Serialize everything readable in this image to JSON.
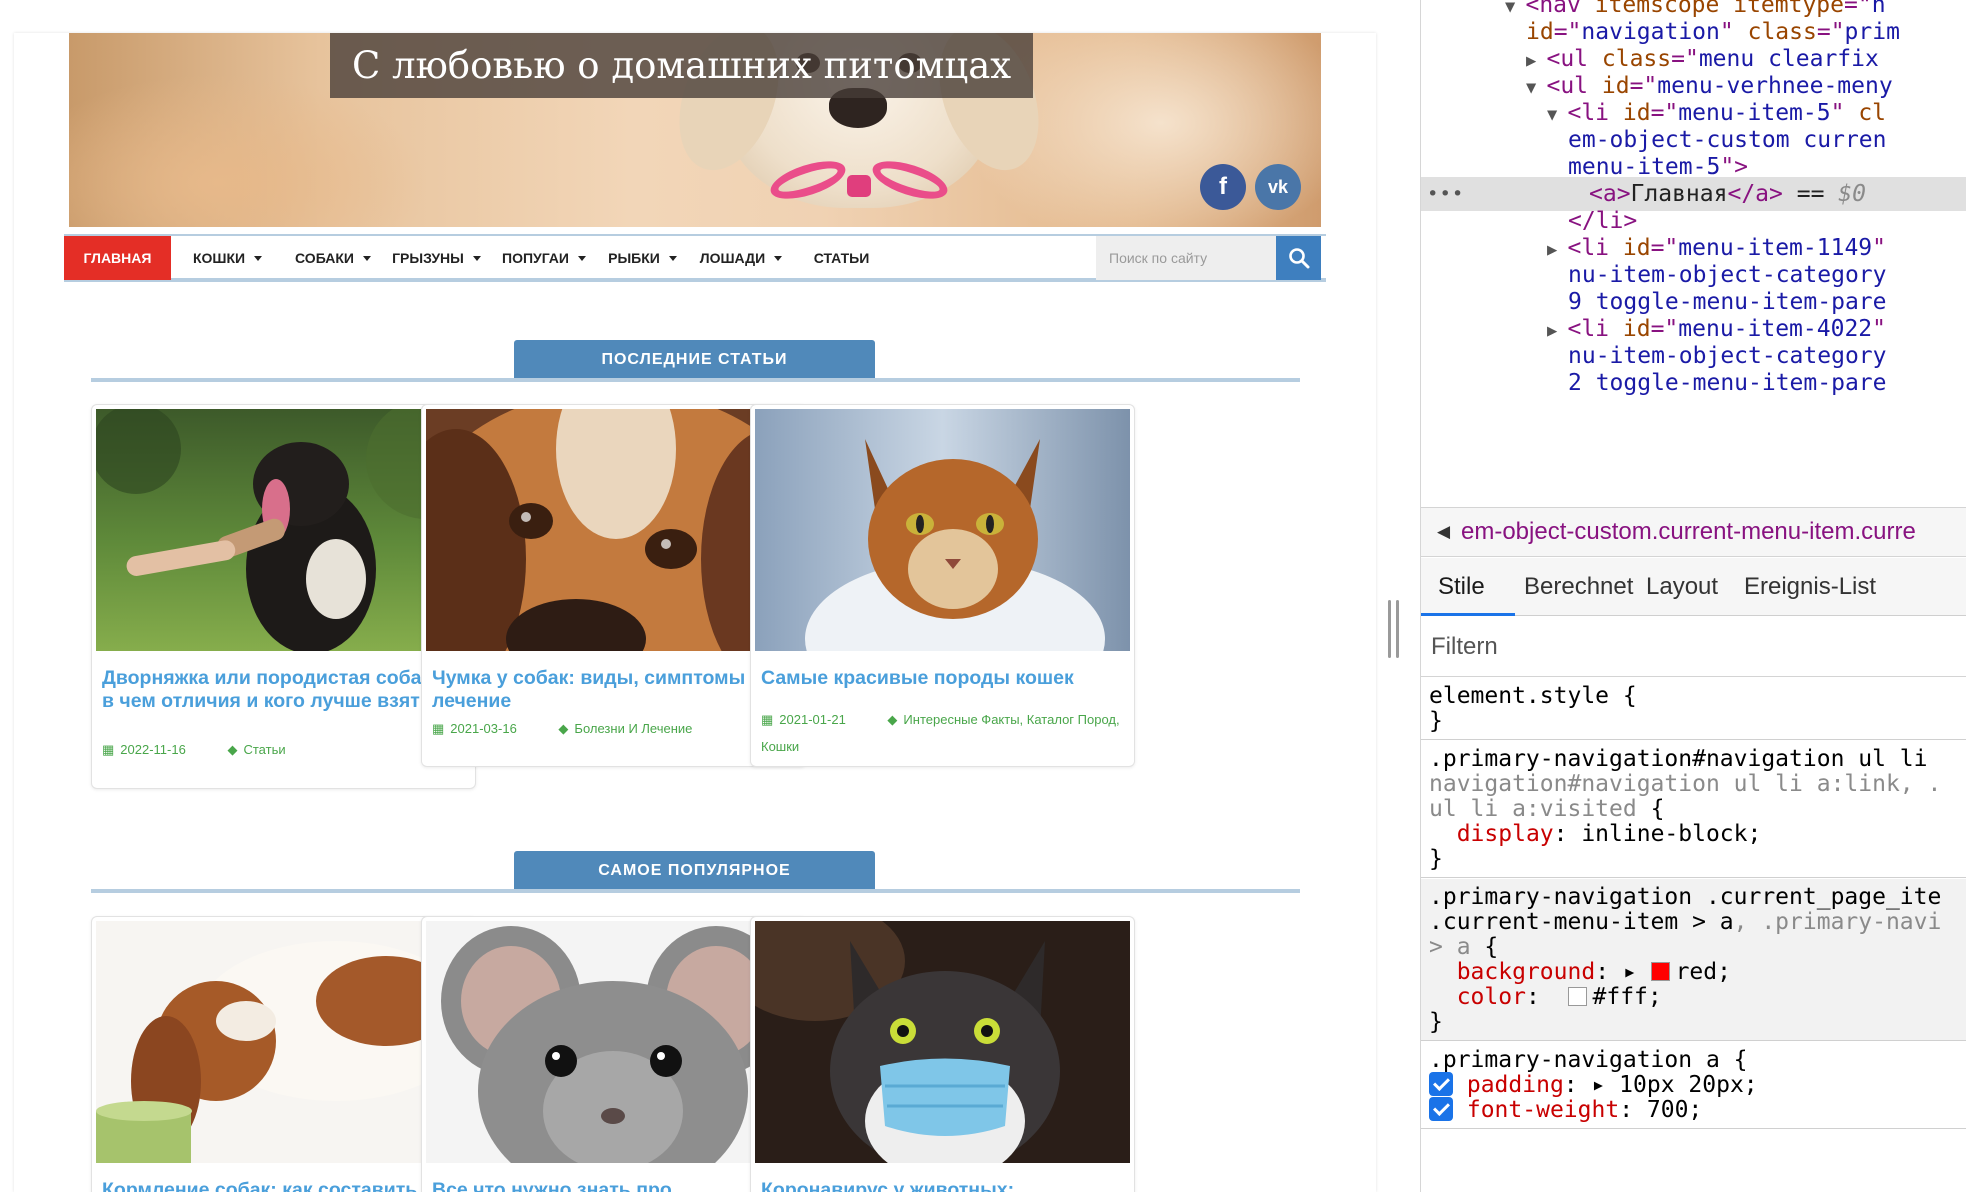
{
  "site": {
    "title": "С любовью о домашних питомцах",
    "social": {
      "facebook": "f",
      "vk": "vk"
    },
    "nav": {
      "items": [
        {
          "label": "Главная",
          "active": true,
          "dropdown": false
        },
        {
          "label": "Кошки",
          "dropdown": true
        },
        {
          "label": "Собаки",
          "dropdown": true
        },
        {
          "label": "Грызуны",
          "dropdown": true
        },
        {
          "label": "Попугаи",
          "dropdown": true
        },
        {
          "label": "Рыбки",
          "dropdown": true
        },
        {
          "label": "Лошади",
          "dropdown": true
        },
        {
          "label": "Статьи",
          "dropdown": false
        }
      ],
      "search_placeholder": "Поиск по сайту"
    },
    "latest": {
      "heading": "Последние статьи",
      "cards": [
        {
          "title": "Дворняжка или породистая собака: в чем отличия и кого лучше взять?",
          "date": "2022-11-16",
          "category": "Статьи",
          "image": "dog-paw-photo"
        },
        {
          "title": "Чумка у собак: виды, симптомы и лечение",
          "date": "2021-03-16",
          "category": "Болезни И Лечение",
          "image": "beagle-photo"
        },
        {
          "title": "Самые красивые породы кошек",
          "date": "2021-01-21",
          "category": "Интересные Факты, Каталог Пород, Кошки",
          "image": "abyssinian-cat-photo"
        }
      ]
    },
    "popular": {
      "heading": "Самое популярное",
      "cards": [
        {
          "title": "Кормление собак: как составить",
          "image": "spaniel-eating-photo"
        },
        {
          "title": "Все что нужно знать про",
          "image": "chinchilla-photo"
        },
        {
          "title": "Коронавирус у животных:",
          "image": "cat-mask-photo"
        }
      ]
    },
    "colors": {
      "accent": "#5089ba",
      "nav_active": "#e42e26",
      "link": "#4a9fdb",
      "meta": "#49a64a"
    }
  },
  "devtools": {
    "dom_lines": [
      {
        "indent": 4,
        "tri": "▼",
        "parts": [
          [
            "tag",
            "<nav "
          ],
          [
            "attr",
            "itemscope"
          ],
          [
            "tag",
            " "
          ],
          [
            "attr",
            "itemtype"
          ],
          [
            "tag",
            "=\""
          ],
          [
            "val",
            "h"
          ]
        ]
      },
      {
        "indent": 5,
        "tri": "",
        "parts": [
          [
            "attr",
            "id"
          ],
          [
            "tag",
            "=\""
          ],
          [
            "val",
            "navigation"
          ],
          [
            "tag",
            "\" "
          ],
          [
            "attr",
            "class"
          ],
          [
            "tag",
            "=\""
          ],
          [
            "val",
            "prim"
          ]
        ]
      },
      {
        "indent": 5,
        "tri": "▶",
        "parts": [
          [
            "tag",
            "<ul "
          ],
          [
            "attr",
            "class"
          ],
          [
            "tag",
            "=\""
          ],
          [
            "val",
            "menu clearfix"
          ]
        ]
      },
      {
        "indent": 5,
        "tri": "▼",
        "parts": [
          [
            "tag",
            "<ul "
          ],
          [
            "attr",
            "id"
          ],
          [
            "tag",
            "=\""
          ],
          [
            "val",
            "menu-verhnee-meny"
          ]
        ]
      },
      {
        "indent": 6,
        "tri": "▼",
        "parts": [
          [
            "tag",
            "<li "
          ],
          [
            "attr",
            "id"
          ],
          [
            "tag",
            "=\""
          ],
          [
            "val",
            "menu-item-5"
          ],
          [
            "tag",
            "\" "
          ],
          [
            "attr",
            "cl"
          ]
        ]
      },
      {
        "indent": 7,
        "tri": "",
        "parts": [
          [
            "val",
            "em-object-custom curren"
          ]
        ]
      },
      {
        "indent": 7,
        "tri": "",
        "parts": [
          [
            "val",
            "menu-item-5"
          ],
          [
            "tag",
            "\">"
          ]
        ]
      },
      {
        "indent": 8,
        "tri": "",
        "selected": true,
        "parts": [
          [
            "tag",
            "<a>"
          ],
          [
            "txt",
            "Главная"
          ],
          [
            "tag",
            "</a>"
          ],
          [
            "txt",
            " == "
          ],
          [
            "dim",
            "$0"
          ]
        ]
      },
      {
        "indent": 7,
        "tri": "",
        "parts": [
          [
            "tag",
            "</li>"
          ]
        ]
      },
      {
        "indent": 6,
        "tri": "▶",
        "parts": [
          [
            "tag",
            "<li "
          ],
          [
            "attr",
            "id"
          ],
          [
            "tag",
            "=\""
          ],
          [
            "val",
            "menu-item-1149"
          ],
          [
            "tag",
            "\""
          ]
        ]
      },
      {
        "indent": 7,
        "tri": "",
        "parts": [
          [
            "val",
            "nu-item-object-category"
          ]
        ]
      },
      {
        "indent": 7,
        "tri": "",
        "parts": [
          [
            "val",
            "9 toggle-menu-item-pare"
          ]
        ]
      },
      {
        "indent": 6,
        "tri": "▶",
        "parts": [
          [
            "tag",
            "<li "
          ],
          [
            "attr",
            "id"
          ],
          [
            "tag",
            "=\""
          ],
          [
            "val",
            "menu-item-4022"
          ],
          [
            "tag",
            "\""
          ]
        ]
      },
      {
        "indent": 7,
        "tri": "",
        "parts": [
          [
            "val",
            "nu-item-object-category"
          ]
        ]
      },
      {
        "indent": 7,
        "tri": "",
        "parts": [
          [
            "val",
            "2 toggle-menu-item-pare"
          ]
        ]
      }
    ],
    "breadcrumb": "em-object-custom.current-menu-item.curre",
    "tabs": [
      "Stile",
      "Berechnet",
      "Layout",
      "Ereignis-List"
    ],
    "filter_placeholder": "Filtern",
    "rules": [
      {
        "lines": [
          [
            [
              "plain",
              "element.style {"
            ]
          ],
          [
            [
              "plain",
              "}"
            ]
          ]
        ]
      },
      {
        "lines": [
          [
            [
              "plain",
              ".primary-navigation#navigation ul li"
            ]
          ],
          [
            [
              "dim",
              "navigation#navigation ul li a:link, ."
            ]
          ],
          [
            [
              "dim",
              "ul li a:visited "
            ],
            [
              "plain",
              "{"
            ]
          ],
          [
            [
              "plain",
              "  "
            ],
            [
              "prop",
              "display"
            ],
            [
              "plain",
              ": inline-block;"
            ]
          ],
          [
            [
              "plain",
              "}"
            ]
          ]
        ]
      },
      {
        "grey": true,
        "lines": [
          [
            [
              "plain",
              ".primary-navigation .current_page_ite"
            ]
          ],
          [
            [
              "plain",
              ".current-menu-item > a"
            ],
            [
              "dim",
              ", .primary-navi"
            ]
          ],
          [
            [
              "dim",
              "> a "
            ],
            [
              "plain",
              "{"
            ]
          ],
          [
            [
              "plain",
              "  "
            ],
            [
              "prop",
              "background"
            ],
            [
              "plain",
              ": ▸ "
            ],
            [
              "swatch",
              "#ff0000"
            ],
            [
              "plain",
              "red;"
            ]
          ],
          [
            [
              "plain",
              "  "
            ],
            [
              "prop",
              "color"
            ],
            [
              "plain",
              ":  "
            ],
            [
              "swatch",
              "#ffffff"
            ],
            [
              "plain",
              "#fff;"
            ]
          ],
          [
            [
              "plain",
              "}"
            ]
          ]
        ]
      },
      {
        "lines": [
          [
            [
              "plain",
              ".primary-navigation a {"
            ]
          ],
          [
            [
              "check",
              ""
            ],
            [
              "plain",
              " "
            ],
            [
              "prop",
              "padding"
            ],
            [
              "plain",
              ": ▸ 10px 20px;"
            ]
          ],
          [
            [
              "check",
              ""
            ],
            [
              "plain",
              " "
            ],
            [
              "prop",
              "font-weight"
            ],
            [
              "plain",
              ": 700;"
            ]
          ]
        ]
      }
    ]
  }
}
